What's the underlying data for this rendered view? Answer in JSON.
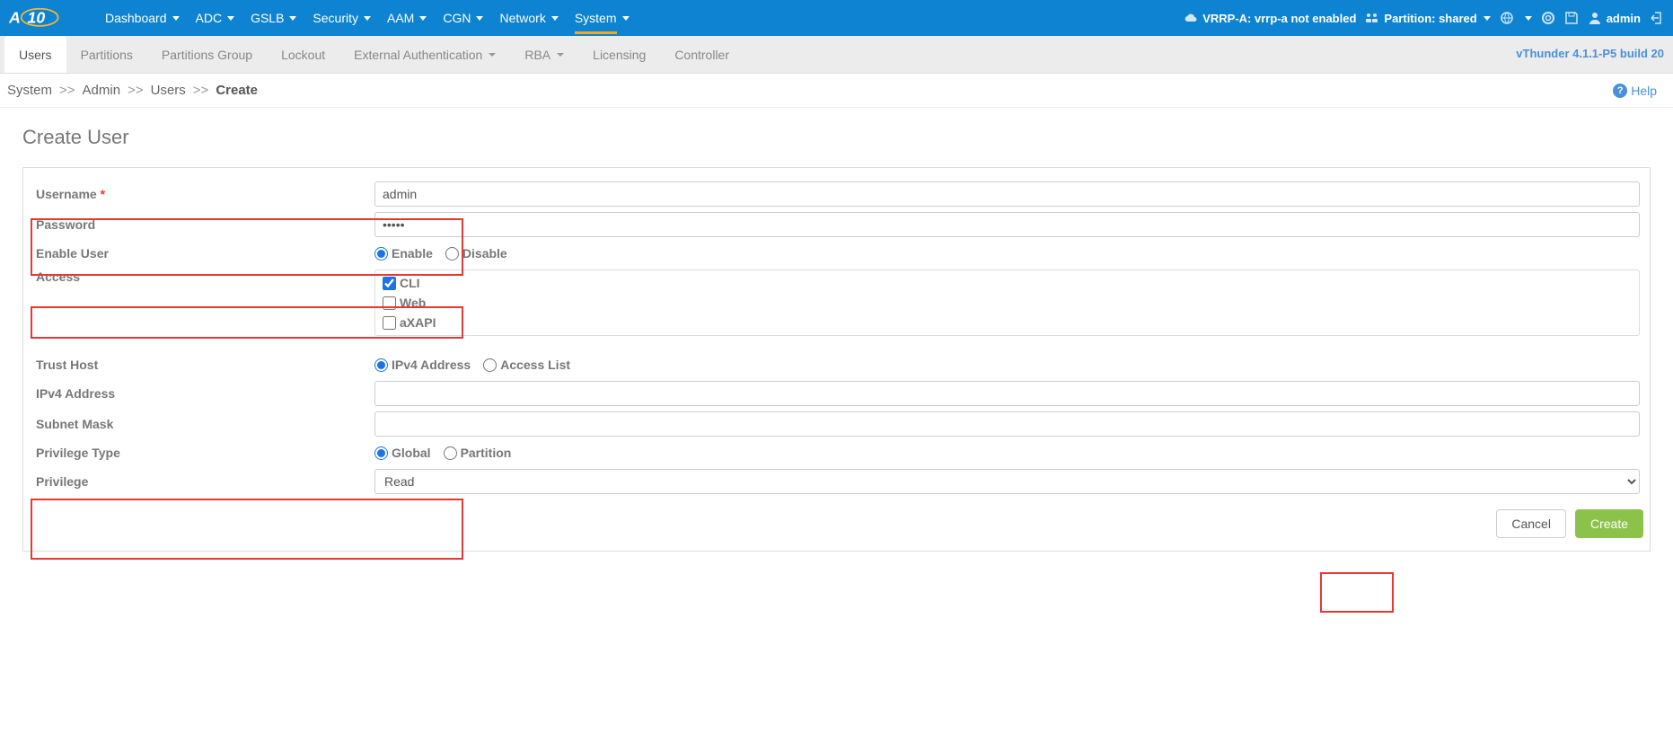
{
  "topnav": {
    "menu": [
      "Dashboard",
      "ADC",
      "GSLB",
      "Security",
      "AAM",
      "CGN",
      "Network",
      "System"
    ],
    "vrrp": "VRRP-A: vrrp-a not enabled",
    "partition_label": "Partition: shared",
    "admin_label": "admin"
  },
  "subnav": {
    "tabs": [
      "Users",
      "Partitions",
      "Partitions Group",
      "Lockout",
      "External Authentication",
      "RBA",
      "Licensing",
      "Controller"
    ],
    "active": "Users",
    "version": "vThunder 4.1.1-P5 build 20"
  },
  "breadcrumb": [
    "System",
    "Admin",
    "Users",
    "Create"
  ],
  "help_label": "Help",
  "page_title": "Create User",
  "form": {
    "labels": {
      "username": "Username",
      "password": "Password",
      "enable_user": "Enable User",
      "access": "Access",
      "trust_host": "Trust Host",
      "ipv4": "IPv4 Address",
      "subnet": "Subnet Mask",
      "priv_type": "Privilege Type",
      "privilege": "Privilege"
    },
    "values": {
      "username": "admin",
      "password": "•••••",
      "enable_user": "Enable",
      "access_cli": true,
      "access_web": false,
      "access_axapi": false,
      "trust_host": "IPv4 Address",
      "priv_type": "Global",
      "privilege": "Read"
    },
    "radio_labels": {
      "enable": "Enable",
      "disable": "Disable",
      "cli": "CLI",
      "web": "Web",
      "axapi": "aXAPI",
      "ipv4": "IPv4 Address",
      "access_list": "Access List",
      "global": "Global",
      "partition": "Partition"
    }
  },
  "buttons": {
    "cancel": "Cancel",
    "create": "Create"
  }
}
